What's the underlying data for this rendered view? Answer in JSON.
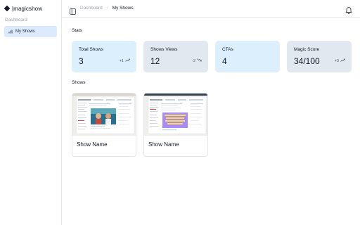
{
  "app": {
    "logo_text": "|magicshow"
  },
  "sidebar": {
    "section_label": "Dashboard",
    "items": [
      {
        "label": "My Shows",
        "active": true
      }
    ]
  },
  "header": {
    "breadcrumb": [
      "Dashboard",
      "/",
      "My Shows"
    ]
  },
  "main": {
    "stats_title": "Stats",
    "stats": [
      {
        "label": "Total Shows",
        "value": "3",
        "delta": "+1",
        "trend": "up"
      },
      {
        "label": "Shows Views",
        "value": "12",
        "delta": "-2",
        "trend": "down"
      },
      {
        "label": "CTAs",
        "value": "4",
        "delta": "",
        "trend": ""
      },
      {
        "label": "Magic Score",
        "value": "34/100",
        "delta": "+3",
        "trend": "up"
      }
    ],
    "shows_title": "Shows",
    "shows": [
      {
        "name": "Show Name"
      },
      {
        "name": "Show Name"
      }
    ]
  },
  "colors": {
    "stat_card_blue": "#dbeffd",
    "stat_card_gray": "#e2e8f0",
    "sidebar_active": "#dbeafe"
  }
}
